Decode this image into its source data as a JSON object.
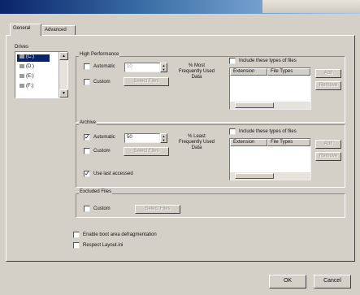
{
  "window": {
    "title": ""
  },
  "tabs": [
    {
      "label": "General"
    },
    {
      "label": "Advanced"
    }
  ],
  "drives": {
    "label": "Drives",
    "items": [
      {
        "label": "(C:)",
        "selected": true
      },
      {
        "label": "(D:)",
        "selected": false
      },
      {
        "label": "(E:)",
        "selected": false
      },
      {
        "label": "(F:)",
        "selected": false
      }
    ]
  },
  "high_performance": {
    "title": "High Performance",
    "automatic_label": "Automatic",
    "automatic_checked": false,
    "automatic_value": "10",
    "unit_label": "% Most Frequently Used Data",
    "custom_label": "Custom",
    "custom_checked": false,
    "select_files_label": "Select Files",
    "include_label": "Include these types of files",
    "include_checked": false,
    "columns": [
      "Extension",
      "File Types"
    ],
    "add_label": "Add",
    "remove_label": "Remove"
  },
  "archive": {
    "title": "Archive",
    "automatic_label": "Automatic",
    "automatic_checked": true,
    "automatic_value": "50",
    "unit_label": "% Least Frequently Used Data",
    "custom_label": "Custom",
    "custom_checked": false,
    "select_files_label": "Select Files",
    "include_label": "Include these types of files",
    "include_checked": false,
    "columns": [
      "Extension",
      "File Types"
    ],
    "add_label": "Add",
    "remove_label": "Remove",
    "use_last_accessed_label": "Use last accessed",
    "use_last_accessed_checked": true
  },
  "excluded": {
    "title": "Excluded Files",
    "custom_label": "Custom",
    "custom_checked": false,
    "select_files_label": "Select Files"
  },
  "options": {
    "boot_defrag_label": "Enable boot area defragmentation",
    "boot_defrag_checked": false,
    "respect_layout_label": "Respect Layout.ini",
    "respect_layout_checked": false
  },
  "footer": {
    "ok_label": "OK",
    "cancel_label": "Cancel"
  },
  "colors": {
    "title_bar": "#0a246a",
    "face": "#d4d0c8",
    "selection": "#0a246a"
  }
}
